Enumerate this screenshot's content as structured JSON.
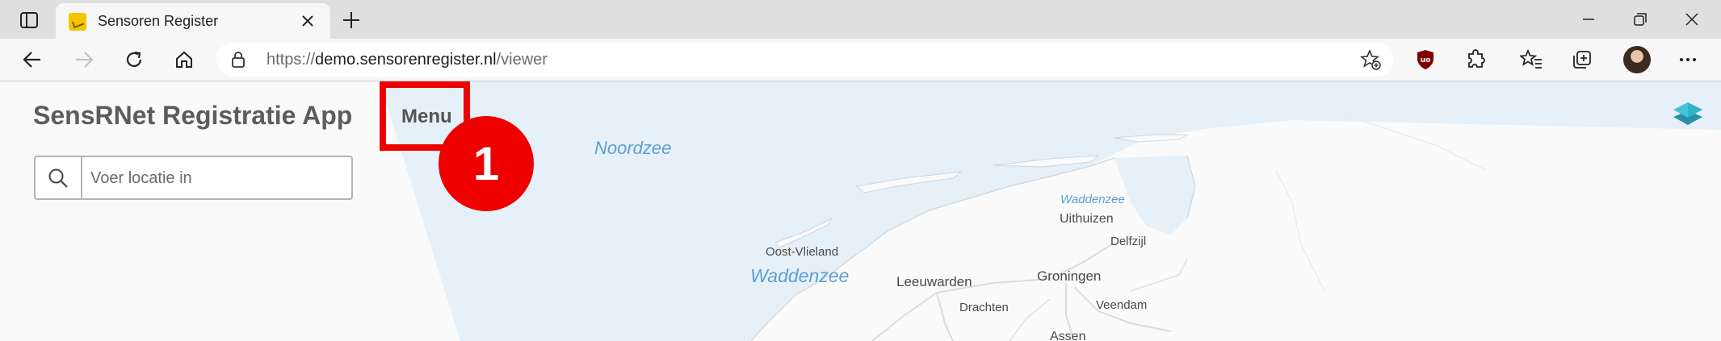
{
  "browser": {
    "tab": {
      "title": "Sensoren Register"
    },
    "address": {
      "url_prefix": "https://",
      "url_domain": "demo.sensorenregister.nl",
      "url_path": "/viewer"
    },
    "icons": {
      "tab_actions": "tab-actions-icon",
      "back": "back-arrow-icon",
      "forward": "forward-arrow-icon",
      "refresh": "refresh-icon",
      "home": "home-icon",
      "lock": "lock-icon",
      "favorite": "add-favorite-icon",
      "extension_ublock": "ublock-icon",
      "extensions": "extensions-icon",
      "favorites": "favorites-icon",
      "collections": "collections-icon",
      "more": "more-icon"
    }
  },
  "app": {
    "title": "SensRNet Registratie App",
    "menu_label": "Menu",
    "search_placeholder": "Voer locatie in",
    "annotation_number": "1"
  },
  "map": {
    "labels": {
      "noordzee": "Noordzee",
      "waddenzee_main": "Waddenzee",
      "waddenzee_small": "Waddenzee",
      "uithuizen": "Uithuizen",
      "delfzijl": "Delfzijl",
      "oost_vlieland": "Oost-Vlieland",
      "leeuwarden": "Leeuwarden",
      "groningen": "Groningen",
      "veendam": "Veendam",
      "drachten": "Drachten",
      "assen": "Assen"
    }
  },
  "colors": {
    "highlight": "#ee0000",
    "sea": "#e6f0f8",
    "land": "#fafafa",
    "sea_label": "#5da0cf"
  }
}
